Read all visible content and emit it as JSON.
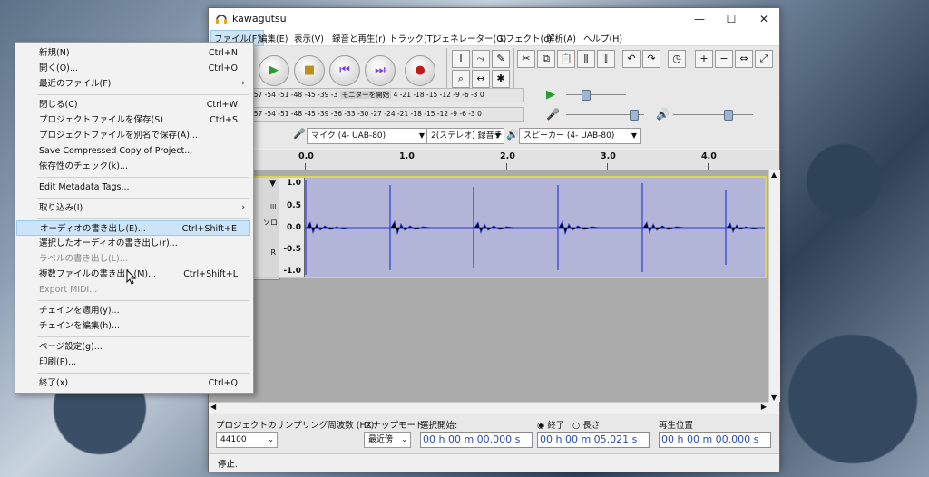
{
  "window": {
    "title": "kawagutsu",
    "minimize": "—",
    "maximize": "☐",
    "close": "✕"
  },
  "menubar": [
    {
      "label": "ファイル(F)"
    },
    {
      "label": "編集(E)"
    },
    {
      "label": "表示(V)"
    },
    {
      "label": "録音と再生(r)"
    },
    {
      "label": "トラック(T)"
    },
    {
      "label": "ジェネレーター(G)"
    },
    {
      "label": "エフェクト(c)"
    },
    {
      "label": "解析(A)"
    },
    {
      "label": "ヘルプ(H)"
    }
  ],
  "meters": {
    "record_scale": "-57 -54 -51 -48 -45  -39 -3",
    "record_monitor": "モニターを開始",
    "record_scale2": "4 -21 -18 -15  -12 -9 -6 -3 0",
    "play_scale": "-57 -54 -51 -48 -45  -39 -36 -33 -30 -27 -24 -21 -18 -15  -12 -9 -6 -3 0"
  },
  "devices": {
    "input": "マイク (4- UAB-80)",
    "channels": "2(ステレオ) 録音チ",
    "output": "スピーカー (4- UAB-80)"
  },
  "ruler": {
    "labels": [
      "0.0",
      "1.0",
      "2.0",
      "3.0",
      "4.0"
    ]
  },
  "track": {
    "scale": [
      "1.0",
      "0.5",
      "0.0",
      "-0.5",
      "-1.0"
    ],
    "ctrl_letters": [
      "ᗯ",
      "ソロ",
      "R"
    ]
  },
  "bottom": {
    "rate_label": "プロジェクトのサンプリング周波数 (Hz):",
    "rate_value": "44100",
    "snap_label": "スナップモード",
    "snap_value": "最近傍",
    "sel_label": "選択開始:",
    "end_label": "終了",
    "length_label": "長さ",
    "pos_label": "再生位置",
    "sel_start": "00 h 00 m 00.000 s",
    "sel_end": "00 h 00 m 05.021 s",
    "play_pos": "00 h 00 m 00.000 s"
  },
  "status": "停止.",
  "file_menu": [
    {
      "label": "新規(N)",
      "shortcut": "Ctrl+N"
    },
    {
      "label": "開く(O)...",
      "shortcut": "Ctrl+O"
    },
    {
      "label": "最近のファイル(F)",
      "shortcut": "",
      "submenu": true
    },
    {
      "label": "閉じる(C)",
      "shortcut": "Ctrl+W"
    },
    {
      "label": "プロジェクトファイルを保存(S)",
      "shortcut": "Ctrl+S"
    },
    {
      "label": "プロジェクトファイルを別名で保存(A)...",
      "shortcut": ""
    },
    {
      "label": "Save Compressed Copy of Project...",
      "shortcut": ""
    },
    {
      "label": "依存性のチェック(k)...",
      "shortcut": ""
    },
    {
      "label": "Edit Metadata Tags...",
      "shortcut": ""
    },
    {
      "label": "取り込み(I)",
      "shortcut": "",
      "submenu": true
    },
    {
      "label": "オーディオの書き出し(E)...",
      "shortcut": "Ctrl+Shift+E",
      "highlight": true
    },
    {
      "label": "選択したオーディオの書き出し(r)...",
      "shortcut": ""
    },
    {
      "label": "ラベルの書き出し(L)...",
      "shortcut": "",
      "disabled": true
    },
    {
      "label": "複数ファイルの書き出し(M)...",
      "shortcut": "Ctrl+Shift+L"
    },
    {
      "label": "Export MIDI...",
      "shortcut": "",
      "disabled": true
    },
    {
      "label": "チェインを適用(y)...",
      "shortcut": ""
    },
    {
      "label": "チェインを編集(h)...",
      "shortcut": ""
    },
    {
      "label": "ページ設定(g)...",
      "shortcut": ""
    },
    {
      "label": "印刷(P)...",
      "shortcut": ""
    },
    {
      "label": "終了(x)",
      "shortcut": "Ctrl+Q"
    }
  ],
  "colors": {
    "waveform_bg": "#b2b4d8",
    "wave": "#2a3bd0",
    "highlight": "#cce4f7",
    "selection_border": "#d8d35a"
  }
}
